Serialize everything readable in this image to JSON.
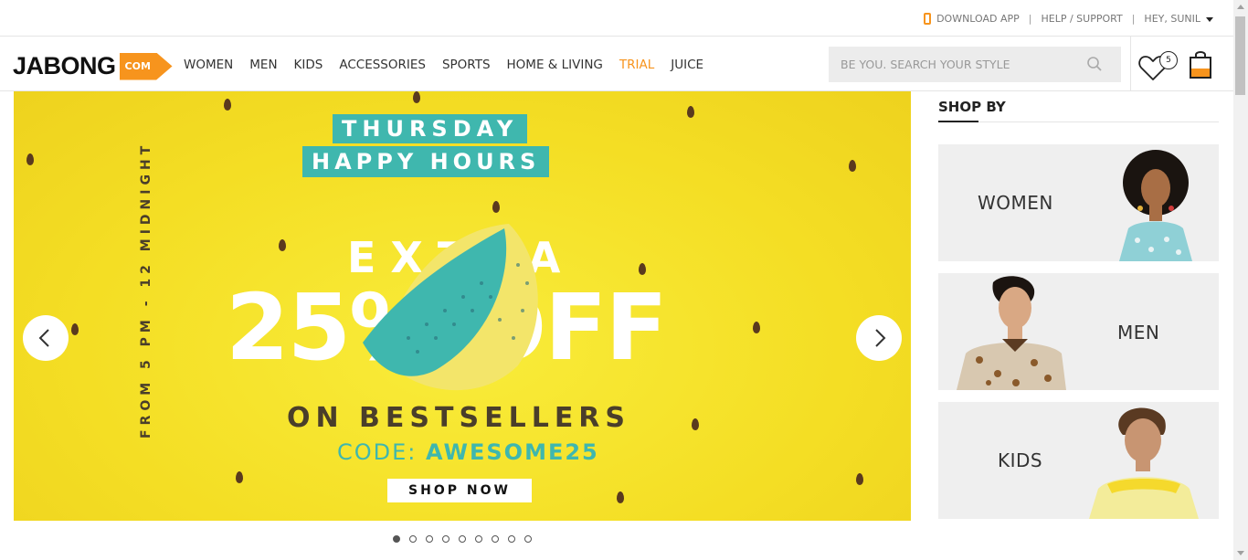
{
  "topbar": {
    "download_app": "DOWNLOAD APP",
    "help_support": "HELP / SUPPORT",
    "greeting": "HEY, SUNIL",
    "separator": "|"
  },
  "header": {
    "logo_text": "JABONG",
    "logo_com": "COM",
    "nav": [
      "WOMEN",
      "MEN",
      "KIDS",
      "ACCESSORIES",
      "SPORTS",
      "HOME & LIVING",
      "TRIAL",
      "JUICE"
    ],
    "search_placeholder": "BE YOU. SEARCH YOUR STYLE",
    "wishlist_count": "5",
    "accent_color": "#f7941d"
  },
  "hero": {
    "tag_line1": "THURSDAY",
    "tag_line2": "HAPPY HOURS",
    "vertical_text": "FROM 5 PM - 12 MIDNIGHT",
    "extra": "EXTRA",
    "discount": "25% OFF",
    "on_bestsellers": "ON BESTSELLERS",
    "code_label": "CODE: ",
    "code_value": "AWESOME25",
    "shop_now": "SHOP NOW",
    "background_color": "#f4de24",
    "teal_color": "#3fb7ae",
    "slide_count": 9,
    "active_slide": 1
  },
  "shop_by": {
    "title": "SHOP BY",
    "categories": [
      "WOMEN",
      "MEN",
      "KIDS"
    ]
  }
}
